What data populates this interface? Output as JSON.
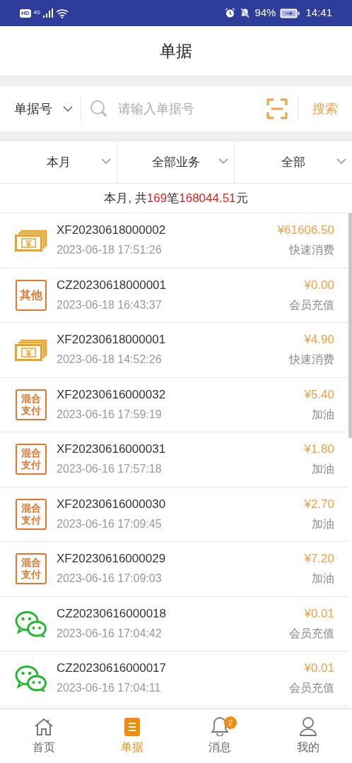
{
  "status_bar": {
    "left": "HD",
    "network": "4G",
    "battery": "94%",
    "time": "14:41"
  },
  "header": {
    "title": "单据"
  },
  "search": {
    "field_type": "单据号",
    "placeholder": "请输入单据号",
    "button": "搜索"
  },
  "filters": [
    {
      "label": "本月"
    },
    {
      "label": "全部业务"
    },
    {
      "label": "全部"
    }
  ],
  "summary": {
    "prefix": "本月, 共",
    "count": "169",
    "middle": "笔",
    "total": "168044.51",
    "suffix": "元"
  },
  "records": [
    {
      "kind": "cash",
      "number": "XF20230618000002",
      "time": "2023-06-18 17:51:26",
      "amount": "¥61606.50",
      "type": "快速消费"
    },
    {
      "kind": "label",
      "icon_text": [
        "其他"
      ],
      "number": "CZ20230618000001",
      "time": "2023-06-18 16:43:37",
      "amount": "¥0.00",
      "type": "会员充值"
    },
    {
      "kind": "cash",
      "number": "XF20230618000001",
      "time": "2023-06-18 14:52:26",
      "amount": "¥4.90",
      "type": "快速消费"
    },
    {
      "kind": "label",
      "icon_text": [
        "混合",
        "支付"
      ],
      "number": "XF20230616000032",
      "time": "2023-06-16 17:59:19",
      "amount": "¥5.40",
      "type": "加油"
    },
    {
      "kind": "label",
      "icon_text": [
        "混合",
        "支付"
      ],
      "number": "XF20230616000031",
      "time": "2023-06-16 17:57:18",
      "amount": "¥1.80",
      "type": "加油"
    },
    {
      "kind": "label",
      "icon_text": [
        "混合",
        "支付"
      ],
      "number": "XF20230616000030",
      "time": "2023-06-16 17:09:45",
      "amount": "¥2.70",
      "type": "加油"
    },
    {
      "kind": "label",
      "icon_text": [
        "混合",
        "支付"
      ],
      "number": "XF20230616000029",
      "time": "2023-06-16 17:09:03",
      "amount": "¥7.20",
      "type": "加油"
    },
    {
      "kind": "wechat",
      "number": "CZ20230616000018",
      "time": "2023-06-16 17:04:42",
      "amount": "¥0.01",
      "type": "会员充值"
    },
    {
      "kind": "wechat",
      "number": "CZ20230616000017",
      "time": "2023-06-16 17:04:11",
      "amount": "¥0.01",
      "type": "会员充值"
    }
  ],
  "nav": [
    {
      "kind": "home",
      "label": "首页",
      "selected": false
    },
    {
      "kind": "doc",
      "label": "单据",
      "selected": true
    },
    {
      "kind": "bell",
      "label": "消息",
      "selected": false,
      "badge": "2"
    },
    {
      "kind": "user",
      "label": "我的",
      "selected": false
    }
  ]
}
